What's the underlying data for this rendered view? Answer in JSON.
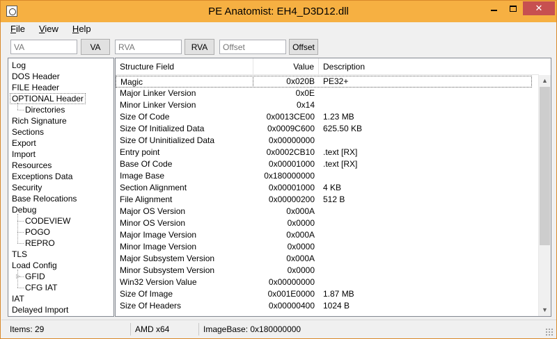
{
  "window": {
    "title": "PE Anatomist: EH4_D3D12.dll",
    "close_glyph": "✕"
  },
  "menu": [
    {
      "key": "F",
      "rest": "ile"
    },
    {
      "key": "V",
      "rest": "iew"
    },
    {
      "key": "H",
      "rest": "elp"
    }
  ],
  "toolbar": {
    "va_placeholder": "VA",
    "va_button": "VA",
    "rva_placeholder": "RVA",
    "rva_button": "RVA",
    "offset_placeholder": "Offset",
    "offset_button": "Offset"
  },
  "tree": [
    {
      "label": "Log",
      "level": 0
    },
    {
      "label": "DOS Header",
      "level": 0
    },
    {
      "label": "FILE Header",
      "level": 0
    },
    {
      "label": "OPTIONAL Header",
      "level": 0,
      "selected": true
    },
    {
      "label": "Directories",
      "level": 1
    },
    {
      "label": "Rich Signature",
      "level": 0
    },
    {
      "label": "Sections",
      "level": 0
    },
    {
      "label": "Export",
      "level": 0
    },
    {
      "label": "Import",
      "level": 0
    },
    {
      "label": "Resources",
      "level": 0
    },
    {
      "label": "Exceptions Data",
      "level": 0
    },
    {
      "label": "Security",
      "level": 0
    },
    {
      "label": "Base Relocations",
      "level": 0
    },
    {
      "label": "Debug",
      "level": 0
    },
    {
      "label": "CODEVIEW",
      "level": 1
    },
    {
      "label": "POGO",
      "level": 1
    },
    {
      "label": "REPRO",
      "level": 1
    },
    {
      "label": "TLS",
      "level": 0
    },
    {
      "label": "Load Config",
      "level": 0
    },
    {
      "label": "GFID",
      "level": 1,
      "expandable": true
    },
    {
      "label": "CFG IAT",
      "level": 1
    },
    {
      "label": "IAT",
      "level": 0
    },
    {
      "label": "Delayed Import",
      "level": 0
    }
  ],
  "grid": {
    "columns": [
      "Structure Field",
      "Value",
      "Description"
    ],
    "rows": [
      {
        "field": "Magic",
        "value": "0x020B",
        "desc": "PE32+",
        "selected": true
      },
      {
        "field": "Major Linker Version",
        "value": "0x0E",
        "desc": ""
      },
      {
        "field": "Minor Linker Version",
        "value": "0x14",
        "desc": ""
      },
      {
        "field": "Size Of Code",
        "value": "0x0013CE00",
        "desc": "1.23 MB"
      },
      {
        "field": "Size Of Initialized Data",
        "value": "0x0009C600",
        "desc": "625.50 KB"
      },
      {
        "field": "Size Of Uninitialized Data",
        "value": "0x00000000",
        "desc": ""
      },
      {
        "field": "Entry point",
        "value": "0x0002CB10",
        "desc": ".text [RX]"
      },
      {
        "field": "Base Of Code",
        "value": "0x00001000",
        "desc": ".text [RX]"
      },
      {
        "field": "Image Base",
        "value": "0x180000000",
        "desc": ""
      },
      {
        "field": "Section Alignment",
        "value": "0x00001000",
        "desc": "4 KB"
      },
      {
        "field": "File Alignment",
        "value": "0x00000200",
        "desc": "512 B"
      },
      {
        "field": "Major OS Version",
        "value": "0x000A",
        "desc": ""
      },
      {
        "field": "Minor OS Version",
        "value": "0x0000",
        "desc": ""
      },
      {
        "field": "Major Image Version",
        "value": "0x000A",
        "desc": ""
      },
      {
        "field": "Minor Image Version",
        "value": "0x0000",
        "desc": ""
      },
      {
        "field": "Major Subsystem Version",
        "value": "0x000A",
        "desc": ""
      },
      {
        "field": "Minor Subsystem Version",
        "value": "0x0000",
        "desc": ""
      },
      {
        "field": "Win32 Version Value",
        "value": "0x00000000",
        "desc": ""
      },
      {
        "field": "Size Of Image",
        "value": "0x001E0000",
        "desc": "1.87 MB"
      },
      {
        "field": "Size Of Headers",
        "value": "0x00000400",
        "desc": "1024 B"
      }
    ]
  },
  "status": {
    "items": "Items: 29",
    "arch": "AMD x64",
    "image_base": "ImageBase: 0x180000000"
  },
  "colors": {
    "titlebar": "#f6b042",
    "close": "#c75050"
  }
}
